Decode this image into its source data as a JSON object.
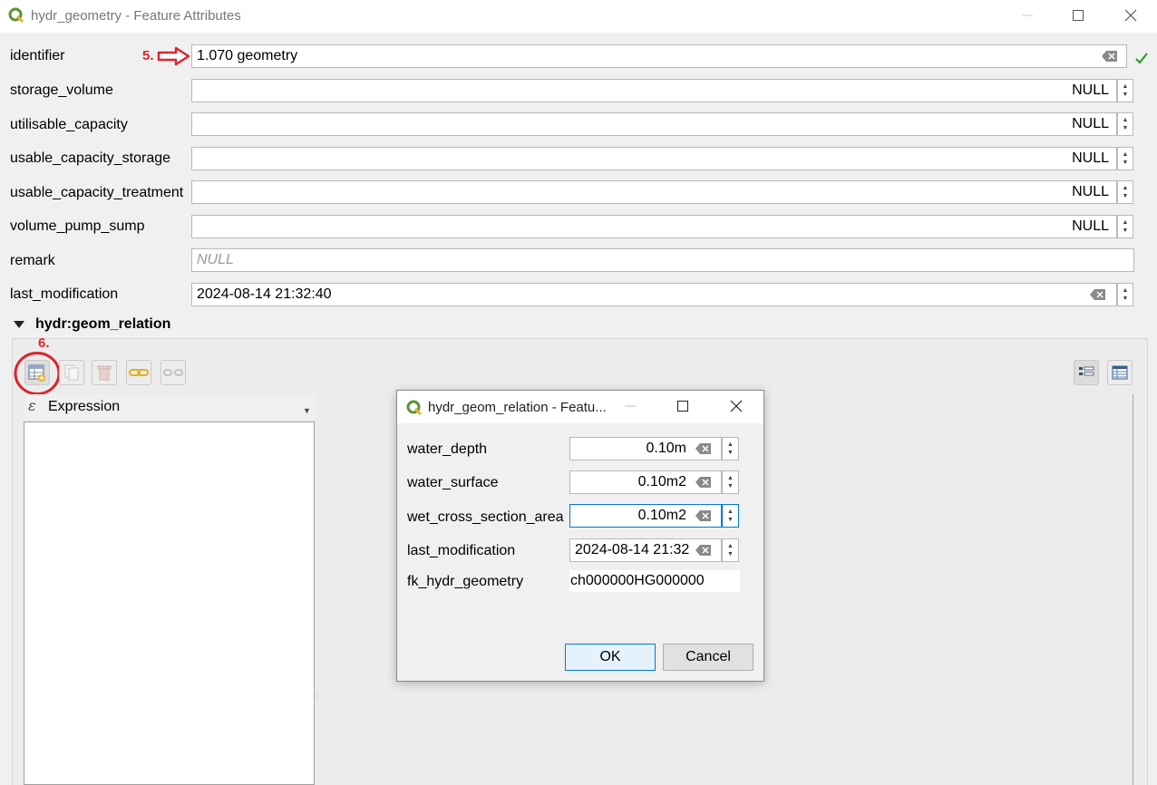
{
  "window": {
    "title": "hydr_geometry - Feature Attributes"
  },
  "fields": [
    {
      "label": "identifier",
      "value": "1.070 geometry"
    },
    {
      "label": "storage_volume",
      "value": "NULL"
    },
    {
      "label": "utilisable_capacity",
      "value": "NULL"
    },
    {
      "label": "usable_capacity_storage",
      "value": "NULL"
    },
    {
      "label": "usable_capacity_treatment",
      "value": "NULL"
    },
    {
      "label": "volume_pump_sump",
      "value": "NULL"
    },
    {
      "label": "remark",
      "placeholder": "NULL"
    },
    {
      "label": "last_modification",
      "value": "2024-08-14 21:32:40"
    }
  ],
  "relation": {
    "title": "hydr:geom_relation",
    "expression_label": "Expression"
  },
  "annotations": {
    "step5": "5.",
    "step6": "6."
  },
  "dialog": {
    "title": "hydr_geom_relation - Featu...",
    "fields": [
      {
        "label": "water_depth",
        "value": "0.10m"
      },
      {
        "label": "water_surface",
        "value": "0.10m2"
      },
      {
        "label": "wet_cross_section_area",
        "value": "0.10m2"
      },
      {
        "label": "last_modification",
        "value": "2024-08-14 21:32"
      },
      {
        "label": "fk_hydr_geometry",
        "value": "ch000000HG000000"
      }
    ],
    "ok_label": "OK",
    "cancel_label": "Cancel"
  },
  "colors": {
    "accent": "#d9262b",
    "valid_check": "#2e9e2e",
    "qgis_green": "#589632"
  }
}
